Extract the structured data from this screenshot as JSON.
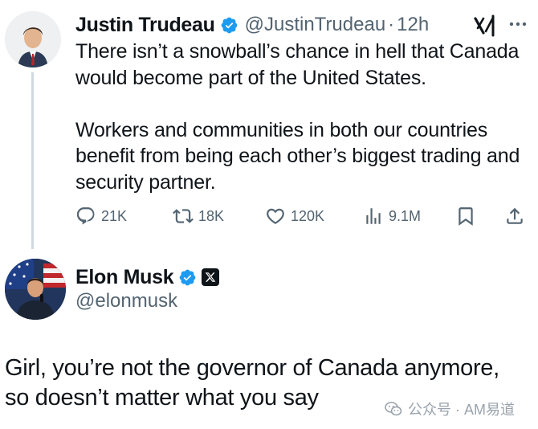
{
  "tweet": {
    "author_name": "Justin Trudeau",
    "handle": "@JustinTrudeau",
    "separator": "·",
    "time": "12h",
    "paragraphs": [
      "There isn’t a snowball’s chance in hell that Canada would become part of the United States.",
      "Workers and communities in both our countries benefit from being each other’s biggest trading and security partner."
    ],
    "actions": {
      "replies": "21K",
      "reposts": "18K",
      "likes": "120K",
      "views": "9.1M"
    }
  },
  "reply": {
    "author_name": "Elon Musk",
    "handle": "@elonmusk",
    "lines": [
      "Girl, you’re not the governor of Canada anymore,",
      "so doesn’t matter what you say"
    ]
  },
  "watermark": {
    "text": "公众号 · AM易道"
  },
  "icons": {
    "verified": "verified-badge-icon",
    "grok": "grok-icon",
    "more": "more-icon",
    "reply": "reply-icon",
    "repost": "repost-icon",
    "like": "like-icon",
    "views": "views-icon",
    "bookmark": "bookmark-icon",
    "share": "share-icon",
    "affiliate": "x-affiliate-icon",
    "wechat": "wechat-icon"
  },
  "colors": {
    "text": "#0f1419",
    "secondary": "#536471",
    "verified_blue": "#1d9bf0",
    "thread_line": "#cfd9de"
  }
}
